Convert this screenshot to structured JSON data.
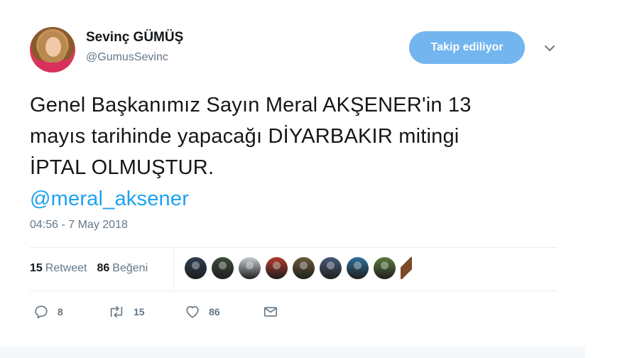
{
  "author": {
    "display_name": "Sevinç GÜMÜŞ",
    "handle": "@GumusSevinc",
    "avatar_icon": "profile-photo"
  },
  "follow_button": {
    "label": "Takip ediliyor",
    "color": "#73b5ef"
  },
  "tweet": {
    "lines": [
      "Genel Başkanımız Sayın Meral AKŞENER'in 13",
      "mayıs tarihinde yapacağı DİYARBAKIR mitingi",
      "İPTAL OLMUŞTUR."
    ],
    "mention": "@meral_aksener",
    "timestamp": "04:56 - 7 May 2018"
  },
  "stats": {
    "retweet_count": "15",
    "retweet_label": "Retweet",
    "like_count": "86",
    "like_label": "Beğeni"
  },
  "likers": [
    {
      "icon": "liker-avatar-1",
      "color": "#2c3e50"
    },
    {
      "icon": "liker-avatar-2",
      "color": "#3d4b3a"
    },
    {
      "icon": "liker-avatar-3",
      "color": "#c8cdd2"
    },
    {
      "icon": "liker-avatar-4",
      "color": "#b23a2e"
    },
    {
      "icon": "liker-avatar-5",
      "color": "#6b5a3a"
    },
    {
      "icon": "liker-avatar-6",
      "color": "#4a5a78"
    },
    {
      "icon": "liker-avatar-7",
      "color": "#2b6f9a"
    },
    {
      "icon": "liker-avatar-8",
      "color": "#5b7a3a"
    },
    {
      "icon": "liker-avatar-9",
      "color": "#7a4a2a"
    }
  ],
  "actions": {
    "reply_count": "8",
    "retweet_count": "15",
    "like_count": "86"
  },
  "colors": {
    "link": "#1da1f2",
    "muted": "#657786",
    "text": "#14171a"
  }
}
